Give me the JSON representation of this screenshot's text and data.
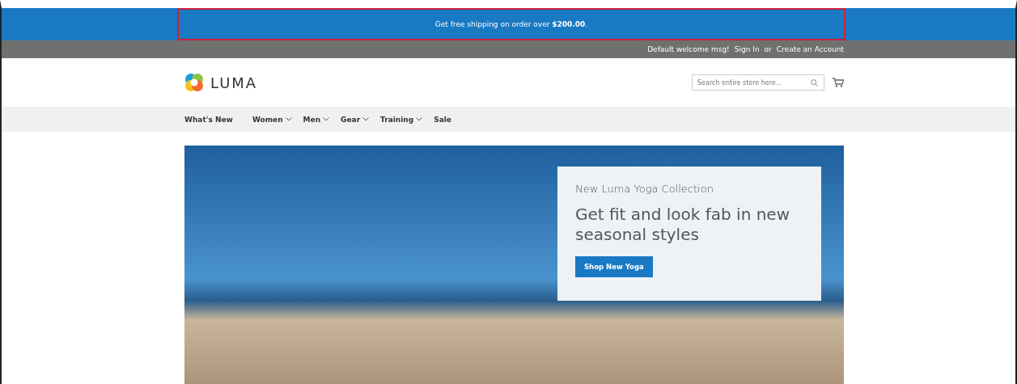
{
  "promo_banner": {
    "text": "Get free shipping on order over **$200.00**."
  },
  "top_bar": {
    "welcome": "Default welcome msg!",
    "sign_in": "Sign In",
    "separator": "or",
    "create_account": "Create an Account"
  },
  "header": {
    "logo_text": "LUMA",
    "search": {
      "placeholder": "Search entire store here..."
    }
  },
  "nav": [
    {
      "label": "What's New",
      "has_dropdown": false
    },
    {
      "label": "Women",
      "has_dropdown": true
    },
    {
      "label": "Men",
      "has_dropdown": true
    },
    {
      "label": "Gear",
      "has_dropdown": true
    },
    {
      "label": "Training",
      "has_dropdown": true
    },
    {
      "label": "Sale",
      "has_dropdown": false
    }
  ],
  "hero": {
    "subtitle": "New Luma Yoga Collection",
    "headline": "Get fit and look fab in new seasonal styles",
    "button": "Shop New Yoga"
  }
}
